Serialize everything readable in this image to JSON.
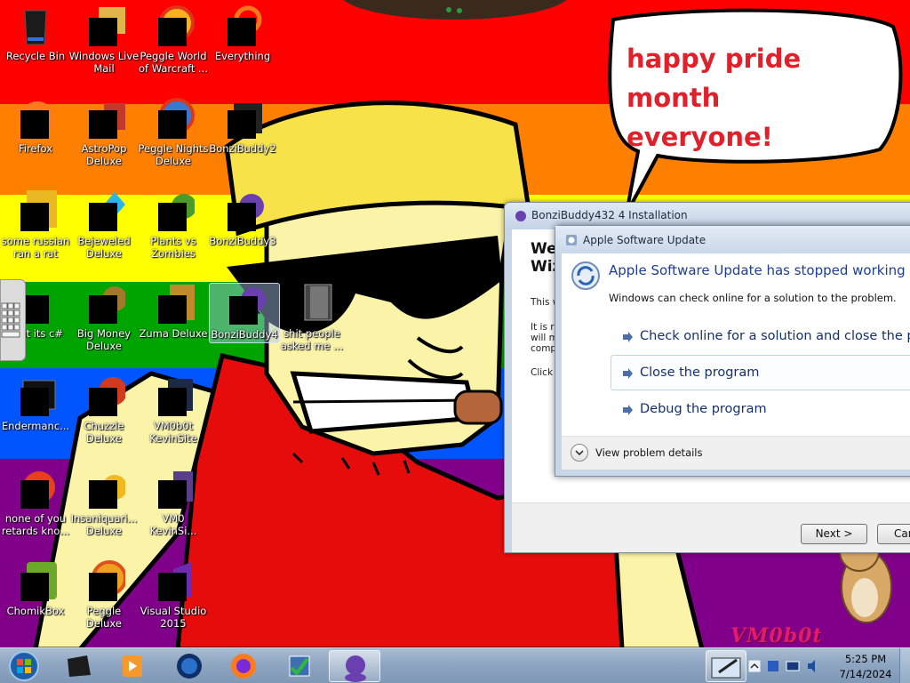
{
  "speech_bubble": {
    "text": "happy pride month\neveryone!"
  },
  "watermark": "VM0b0t",
  "desktop_icons": [
    {
      "label": "Recycle Bin"
    },
    {
      "label": "Windows Live Mail"
    },
    {
      "label": "Peggle World of Warcraft ..."
    },
    {
      "label": "Everything"
    },
    {
      "label": "Firefox"
    },
    {
      "label": "AstroPop Deluxe"
    },
    {
      "label": "Peggle Nights Deluxe"
    },
    {
      "label": "BonziBuddy2"
    },
    {
      "label": "some russian ran a rat"
    },
    {
      "label": "Bejeweled Deluxe"
    },
    {
      "label": "Plants vs Zombies"
    },
    {
      "label": "BonziBuddy3"
    },
    {
      "label": "shut its c#"
    },
    {
      "label": "Big Money Deluxe"
    },
    {
      "label": "Zuma Deluxe"
    },
    {
      "label": "BonziBuddy4"
    },
    {
      "label": "shit people asked me ..."
    },
    {
      "label": "Endermanc..."
    },
    {
      "label": "Chuzzle Deluxe"
    },
    {
      "label": "VM0b0t KevinSite"
    },
    {
      "label": "none of you retards kno..."
    },
    {
      "label": "Insaniquari... Deluxe"
    },
    {
      "label": "VM0 KevinSi..."
    },
    {
      "label": "ChomikBox"
    },
    {
      "label": "Peggle Deluxe"
    },
    {
      "label": "Visual Studio 2015"
    }
  ],
  "installer_window": {
    "title": "BonziBuddy432 4 Installation",
    "heading": "We\nWiz",
    "line1": "This w",
    "line2": "It is re\nwill ma\ncompu",
    "line3": "Click N",
    "next_label": "Next >",
    "cancel_label": "Can"
  },
  "error_dialog": {
    "title": "Apple Software Update",
    "heading": "Apple Software Update has stopped working",
    "subtext": "Windows can check online for a solution to the problem.",
    "options": [
      {
        "label": "Check online for a solution and close the pro"
      },
      {
        "label": "Close the program"
      },
      {
        "label": "Debug the program"
      }
    ],
    "details_label": "View problem details"
  },
  "taskbar": {
    "pinned": [
      "start-orb",
      "taskbar-app",
      "media-player",
      "globe",
      "firefox",
      "bonzi-installer",
      "bonzibuddy"
    ],
    "time": "5:25 PM",
    "date": "7/14/2024"
  },
  "colors": {
    "red": "#fe0000",
    "orange": "#ff7f00",
    "yellow": "#ffff00",
    "green": "#00a400",
    "blue": "#0055ff",
    "purple": "#80008a",
    "bubble_text": "#e0202a",
    "dialog_heading": "#1e3d96"
  }
}
